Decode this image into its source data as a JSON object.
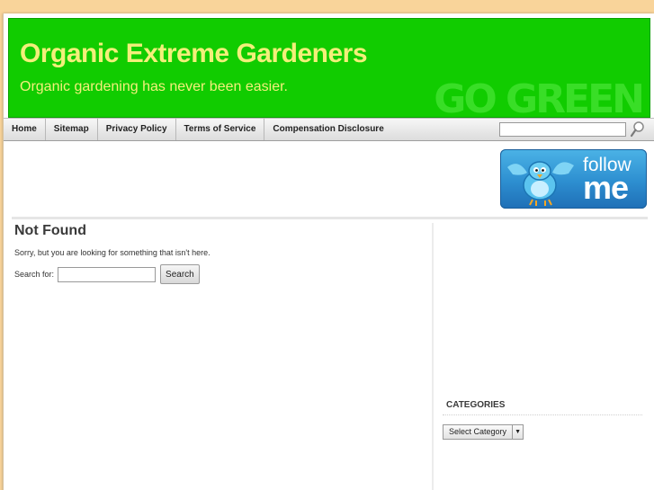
{
  "header": {
    "title": "Organic Extreme Gardeners",
    "description": "Organic gardening has never been easier.",
    "badge_text": "GO GREEN"
  },
  "nav": {
    "items": [
      {
        "label": "Home"
      },
      {
        "label": "Sitemap"
      },
      {
        "label": "Privacy Policy"
      },
      {
        "label": "Terms of Service"
      },
      {
        "label": "Compensation Disclosure"
      }
    ],
    "search_placeholder": ""
  },
  "twitter": {
    "follow_text": "follow",
    "me_text": "me"
  },
  "main": {
    "heading": "Not Found",
    "message": "Sorry, but you are looking for something that isn't here.",
    "search_label": "Search for:",
    "search_value": "",
    "search_button": "Search"
  },
  "sidebar": {
    "categories_heading": "CATEGORIES",
    "category_select": "Select Category"
  },
  "colors": {
    "header_bg": "#11cc00",
    "title_text": "#f3ef7a",
    "page_bg": "#f9d49a"
  }
}
